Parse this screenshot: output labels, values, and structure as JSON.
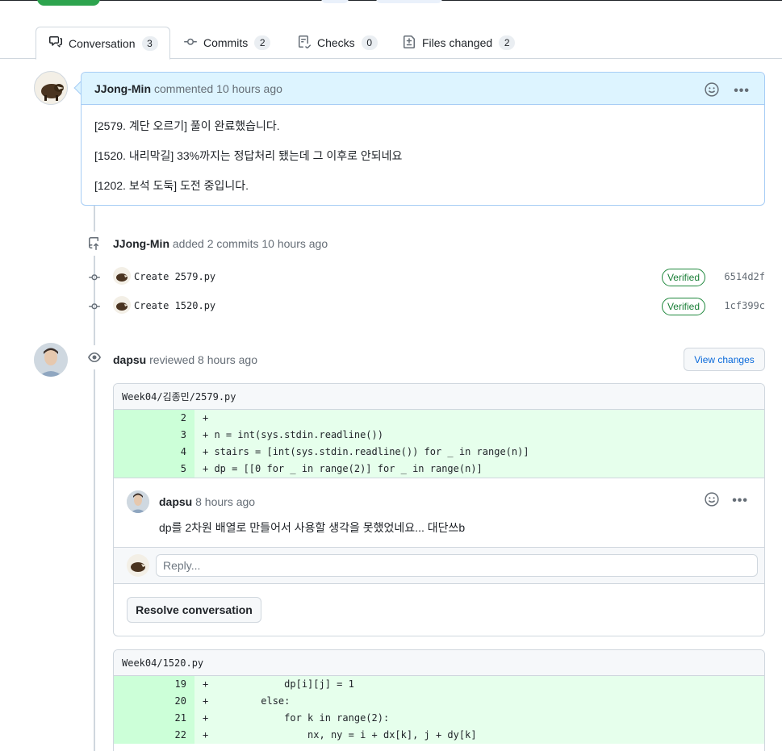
{
  "tabs": [
    {
      "label": "Conversation",
      "count": "3"
    },
    {
      "label": "Commits",
      "count": "2"
    },
    {
      "label": "Checks",
      "count": "0"
    },
    {
      "label": "Files changed",
      "count": "2"
    }
  ],
  "comment": {
    "author": "JJong-Min",
    "action": "commented",
    "time": "10 hours ago",
    "lines": [
      "[2579. 계단 오르기] 풀이 완료했습니다.",
      "[1520. 내리막길] 33%까지는 정답처리 됐는데 그 이후로 안되네요",
      "[1202. 보석 도둑] 도전 중입니다."
    ]
  },
  "commits_event": {
    "author": "JJong-Min",
    "text": "added 2 commits",
    "time": "10 hours ago",
    "commits": [
      {
        "message": "Create 2579.py",
        "verified": "Verified",
        "sha": "6514d2f"
      },
      {
        "message": "Create 1520.py",
        "verified": "Verified",
        "sha": "1cf399c"
      }
    ]
  },
  "review": {
    "author": "dapsu",
    "action": "reviewed",
    "time": "8 hours ago",
    "view_changes": "View changes",
    "file1": {
      "path": "Week04/김종민/2579.py",
      "lines": [
        {
          "num": "2",
          "code": "+"
        },
        {
          "num": "3",
          "code": "+ n = int(sys.stdin.readline())"
        },
        {
          "num": "4",
          "code": "+ stairs = [int(sys.stdin.readline()) for _ in range(n)]"
        },
        {
          "num": "5",
          "code": "+ dp = [[0 for _ in range(2)] for _ in range(n)]"
        }
      ],
      "reply_comment": {
        "author": "dapsu",
        "time": "8 hours ago",
        "body": "dp를 2차원 배열로 만들어서 사용할 생각을 못했었네요... 대단쓰b"
      },
      "reply_placeholder": "Reply...",
      "resolve": "Resolve conversation"
    },
    "file2": {
      "path": "Week04/1520.py",
      "lines": [
        {
          "num": "19",
          "code": "+             dp[i][j] = 1"
        },
        {
          "num": "20",
          "code": "+         else:"
        },
        {
          "num": "21",
          "code": "+             for k in range(2):"
        },
        {
          "num": "22",
          "code": "+                 nx, ny = i + dx[k], j + dy[k]"
        }
      ]
    }
  },
  "colors": {
    "accent": "#0969da",
    "verified": "#1a7f37",
    "diff_add": "#e6ffec",
    "comment_header": "#ddf4ff"
  }
}
